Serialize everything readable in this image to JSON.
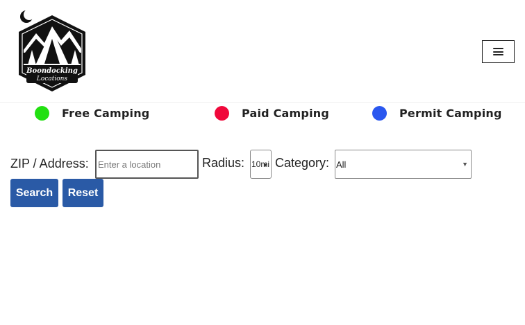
{
  "logo": {
    "line1": "Boondocking",
    "line2": "Locations"
  },
  "nav": {
    "menu_icon": "hamburger-menu-icon"
  },
  "legend": [
    {
      "label": "Free Camping",
      "color": "#22e011"
    },
    {
      "label": "Paid Camping",
      "color": "#f0083b"
    },
    {
      "label": "Permit Camping",
      "color": "#2a57ef"
    }
  ],
  "search_form": {
    "zip_label": "ZIP / Address:",
    "zip_placeholder": "Enter a location",
    "zip_value": "",
    "radius_label": "Radius:",
    "radius_value": "10mi",
    "category_label": "Category:",
    "category_value": "All",
    "search_button": "Search",
    "reset_button": "Reset"
  },
  "colors": {
    "button_bg": "#2a5aa6"
  }
}
